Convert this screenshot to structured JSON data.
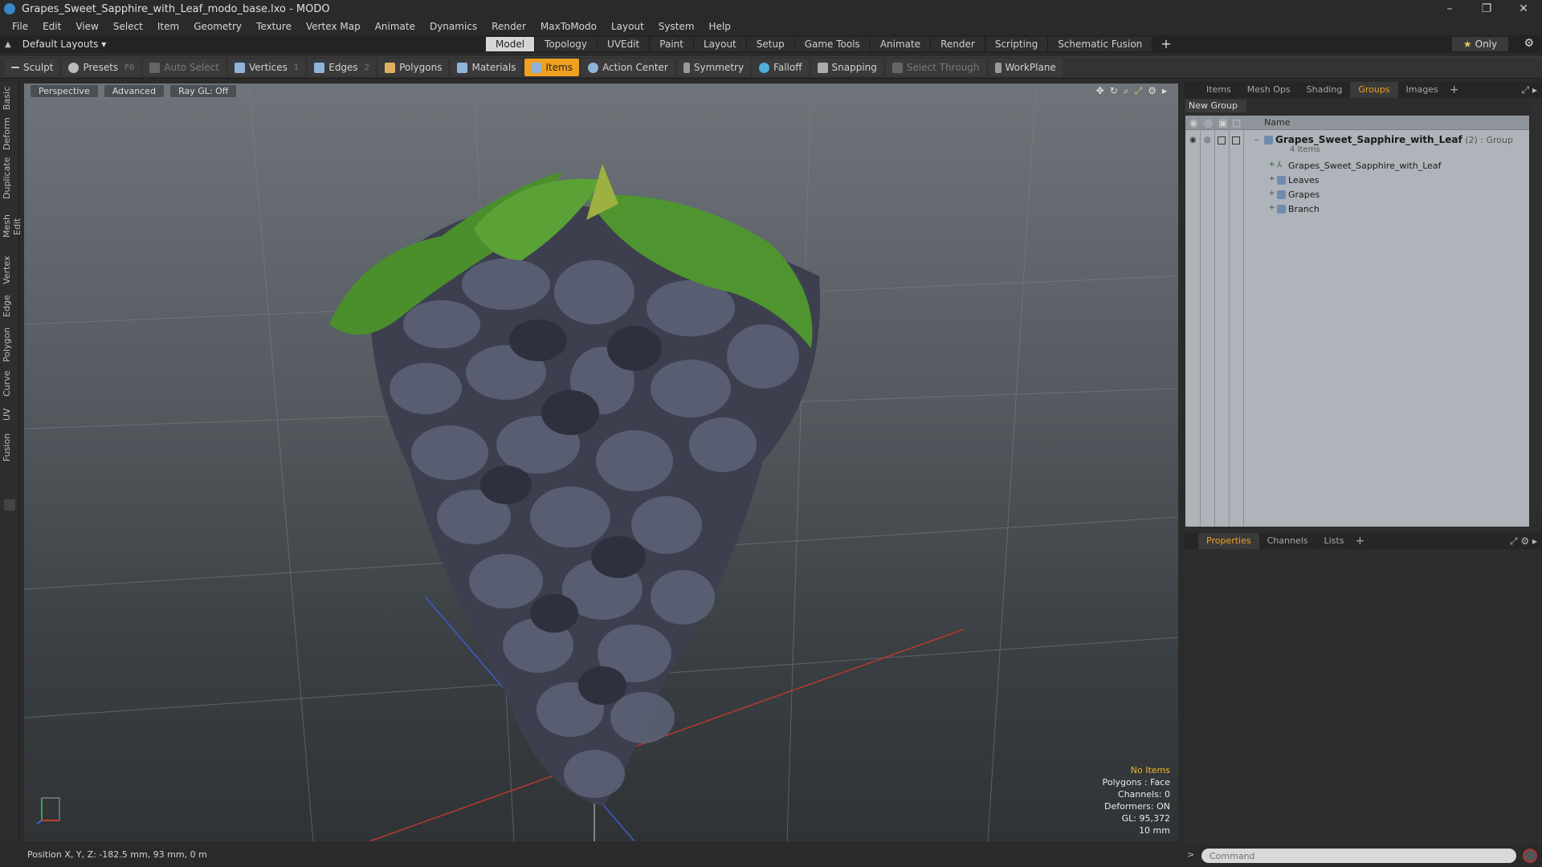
{
  "window": {
    "title": "Grapes_Sweet_Sapphire_with_Leaf_modo_base.lxo - MODO",
    "controls": [
      "–",
      "❐",
      "✕"
    ]
  },
  "menu": [
    "File",
    "Edit",
    "View",
    "Select",
    "Item",
    "Geometry",
    "Texture",
    "Vertex Map",
    "Animate",
    "Dynamics",
    "Render",
    "MaxToModo",
    "Layout",
    "System",
    "Help"
  ],
  "layoutbar": {
    "layout_select": "Default Layouts ▾",
    "tabs": [
      "Model",
      "Topology",
      "UVEdit",
      "Paint",
      "Layout",
      "Setup",
      "Game Tools",
      "Animate",
      "Render",
      "Scripting",
      "Schematic Fusion"
    ],
    "active_tab": "Model",
    "only_label": "Only"
  },
  "toolbar": {
    "sculpt": "Sculpt",
    "presets": "Presets",
    "presets_key": "F6",
    "auto_select": "Auto Select",
    "vertices": "Vertices",
    "vertices_key": "1",
    "edges": "Edges",
    "edges_key": "2",
    "polygons": "Polygons",
    "materials": "Materials",
    "items": "Items",
    "action_center": "Action Center",
    "symmetry": "Symmetry",
    "falloff": "Falloff",
    "snapping": "Snapping",
    "select_through": "Select Through",
    "workplane": "WorkPlane"
  },
  "left_tabs": [
    "Basic",
    "Deform",
    "Duplicate",
    "Mesh Edit",
    "Vertex",
    "Edge",
    "Polygon",
    "Curve",
    "UV",
    "Fusion"
  ],
  "viewport": {
    "perspective": "Perspective",
    "advanced": "Advanced",
    "raygl": "Ray GL: Off",
    "stats": {
      "no_items": "No Items",
      "polygons": "Polygons : Face",
      "channels": "Channels: 0",
      "deformers": "Deformers: ON",
      "gl": "GL: 95,372",
      "scale": "10 mm"
    }
  },
  "position_bar": "Position X, Y, Z:  -182.5 mm, 93 mm, 0 m",
  "groups_panel": {
    "tabs": [
      "Items",
      "Mesh Ops",
      "Shading",
      "Groups",
      "Images"
    ],
    "active_tab": "Groups",
    "new_group": "New Group",
    "name_header": "Name",
    "group_name": "Grapes_Sweet_Sapphire_with_Leaf",
    "group_count": "(2)",
    "group_type": ": Group",
    "group_items": "4 Items",
    "children": [
      "Grapes_Sweet_Sapphire_with_Leaf",
      "Leaves",
      "Grapes",
      "Branch"
    ]
  },
  "properties_panel": {
    "tabs": [
      "Properties",
      "Channels",
      "Lists"
    ],
    "active_tab": "Properties"
  },
  "command": {
    "placeholder": "Command"
  },
  "colors": {
    "accent": "#f0a020",
    "active_tab_bg": "#d6d6d6",
    "viewport_top": "#6e7479",
    "leaf_green": "#4a8f2c",
    "grape_dark": "#3f4152"
  }
}
